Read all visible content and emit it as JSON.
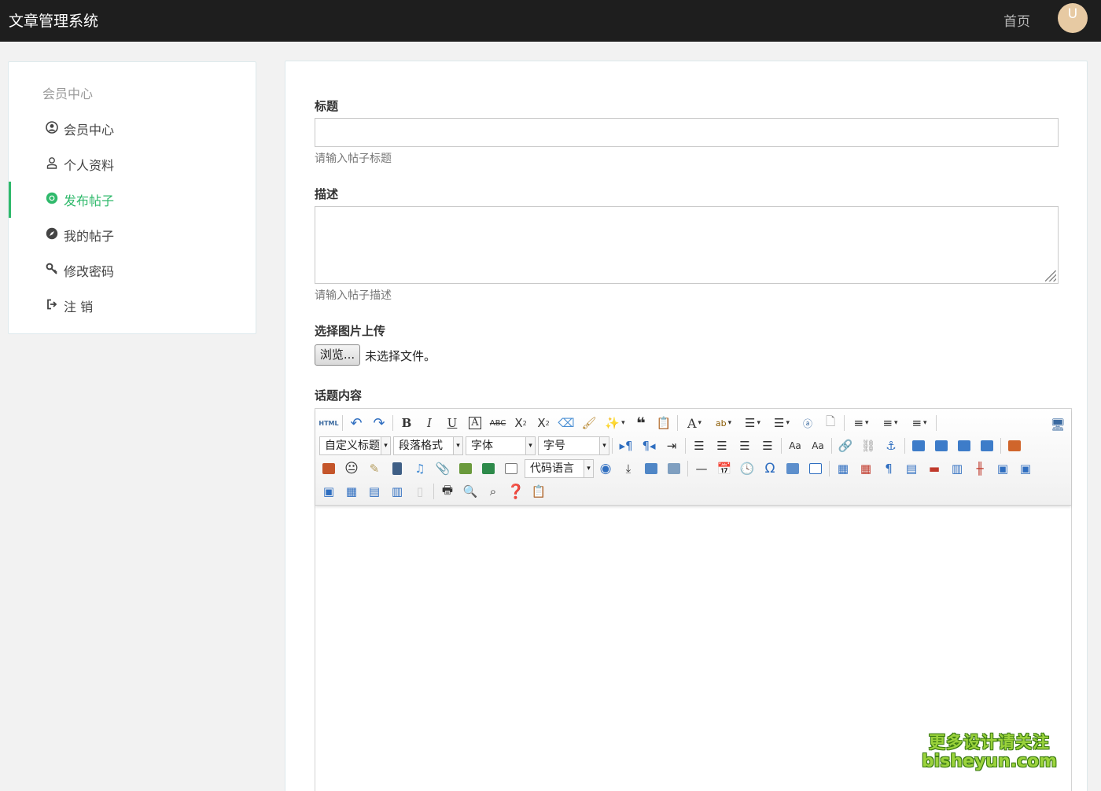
{
  "header": {
    "brand": "文章管理系统",
    "home_link": "首页",
    "avatar_letter": "U",
    "avatar_color": "#e7caa3"
  },
  "sidebar": {
    "title": "会员中心",
    "items": [
      {
        "label": "会员中心",
        "icon": "user-circle-icon",
        "active": false
      },
      {
        "label": "个人资料",
        "icon": "user-outline-icon",
        "active": false
      },
      {
        "label": "发布帖子",
        "icon": "chrome-icon",
        "active": true
      },
      {
        "label": "我的帖子",
        "icon": "compass-icon",
        "active": false
      },
      {
        "label": "修改密码",
        "icon": "key-icon",
        "active": false
      },
      {
        "label": "注 销",
        "icon": "sign-out-icon",
        "active": false
      }
    ],
    "accent_color": "#2fb96b"
  },
  "form": {
    "title_label": "标题",
    "title_value": "",
    "title_help": "请输入帖子标题",
    "desc_label": "描述",
    "desc_value": "",
    "desc_help": "请输入帖子描述",
    "image_label": "选择图片上传",
    "browse_button": "浏览...",
    "file_status": "未选择文件。",
    "content_label": "话题内容"
  },
  "editor": {
    "html_button": "HTML",
    "selects": {
      "custom_heading": "自定义标题",
      "paragraph_format": "段落格式",
      "font_family": "字体",
      "font_size": "字号",
      "code_language": "代码语言"
    },
    "content": ""
  },
  "watermark": {
    "line1": "更多设计请关注",
    "line2": "bisheyun.com"
  }
}
